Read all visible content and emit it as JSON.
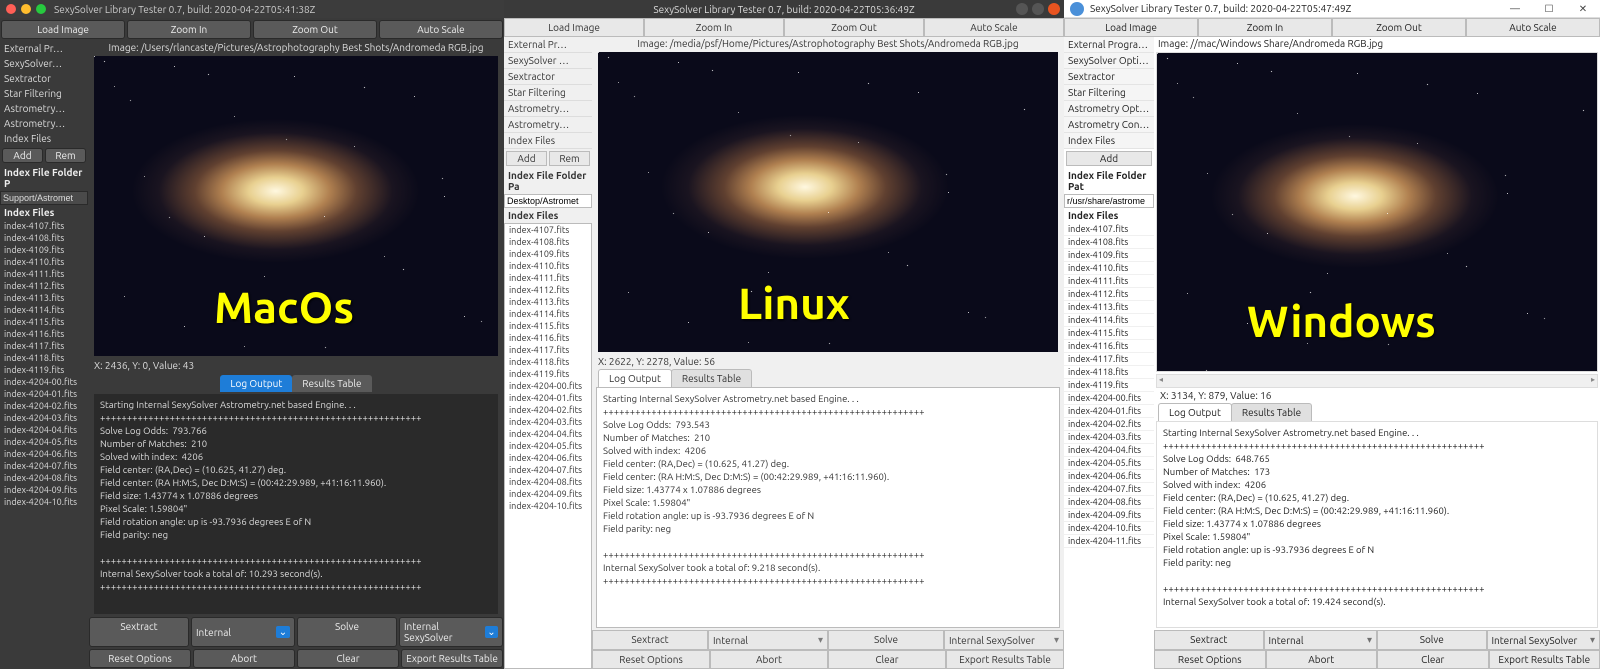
{
  "app_title_base": "SexySolver Library Tester 0.7, build:",
  "mac": {
    "title": "SexySolver Library Tester 0.7, build: 2020-04-22T05:41:38Z",
    "image_path": "Image: /Users/rlancaste/Pictures/Astrophotography Best Shots/Andromeda RGB.jpg",
    "status": "X: 2436, Y: 0, Value: 43",
    "label": "MacOs",
    "sidebar": {
      "options": [
        "External Pr…",
        "SexySolver…",
        "Sextractor",
        "Star Filtering",
        "Astrometry…",
        "Astrometry…",
        "Index Files"
      ],
      "add": "Add",
      "rem": "Rem",
      "folder_header": "Index File Folder P",
      "folder_path": "Support/Astromet",
      "files_header": "Index Files",
      "files": [
        "index-4107.fits",
        "index-4108.fits",
        "index-4109.fits",
        "index-4110.fits",
        "index-4111.fits",
        "index-4112.fits",
        "index-4113.fits",
        "index-4114.fits",
        "index-4115.fits",
        "index-4116.fits",
        "index-4117.fits",
        "index-4118.fits",
        "index-4119.fits",
        "index-4204-00.fits",
        "index-4204-01.fits",
        "index-4204-02.fits",
        "index-4204-03.fits",
        "index-4204-04.fits",
        "index-4204-05.fits",
        "index-4204-06.fits",
        "index-4204-07.fits",
        "index-4204-08.fits",
        "index-4204-09.fits",
        "index-4204-10.fits"
      ]
    },
    "tabs": {
      "log": "Log Output",
      "results": "Results Table"
    },
    "log": "Starting Internal SexySolver Astrometry.net based Engine. . .\n++++++++++++++++++++++++++++++++++++++++++++++++++++++++++++\nSolve Log Odds:  793.766\nNumber of Matches:  210\nSolved with index:  4206\nField center: (RA,Dec) = (10.625, 41.27) deg.\nField center: (RA H:M:S, Dec D:M:S) = (00:42:29.989, +41:16:11.960).\nField size: 1.43774 x 1.07886 degrees\nPixel Scale: 1.59804\"\nField rotation angle: up is -93.7936 degrees E of N\nField parity: neg\n\n++++++++++++++++++++++++++++++++++++++++++++++++++++++++++++\nInternal SexySolver took a total of: 10.293 second(s).\n++++++++++++++++++++++++++++++++++++++++++++++++++++++++++++",
    "bottom1": {
      "sextract": "Sextract",
      "sel1": "Internal",
      "solve": "Solve",
      "sel2": "Internal SexySolver"
    },
    "bottom2": {
      "reset": "Reset Options",
      "abort": "Abort",
      "clear": "Clear",
      "export": "Export Results Table"
    }
  },
  "linux": {
    "title": "SexySolver Library Tester 0.7, build: 2020-04-22T05:36:49Z",
    "image_path": "Image: /media/psf/Home/Pictures/Astrophotography Best Shots/Andromeda RGB.jpg",
    "status": "X: 2622, Y: 2278, Value: 56",
    "label": "Linux",
    "sidebar": {
      "options": [
        "External Pr…",
        "SexySolver …",
        "Sextractor",
        "Star Filtering",
        "Astrometry…",
        "Astrometry…",
        "Index Files"
      ],
      "add": "Add",
      "rem": "Rem",
      "folder_header": "Index File Folder Pa",
      "folder_path": "Desktop/Astromet",
      "files_header": "Index Files",
      "files": [
        "index-4107.fits",
        "index-4108.fits",
        "index-4109.fits",
        "index-4110.fits",
        "index-4111.fits",
        "index-4112.fits",
        "index-4113.fits",
        "index-4114.fits",
        "index-4115.fits",
        "index-4116.fits",
        "index-4117.fits",
        "index-4118.fits",
        "index-4119.fits",
        "index-4204-00.fits",
        "index-4204-01.fits",
        "index-4204-02.fits",
        "index-4204-03.fits",
        "index-4204-04.fits",
        "index-4204-05.fits",
        "index-4204-06.fits",
        "index-4204-07.fits",
        "index-4204-08.fits",
        "index-4204-09.fits",
        "index-4204-10.fits"
      ]
    },
    "tabs": {
      "log": "Log Output",
      "results": "Results Table"
    },
    "log": "Starting Internal SexySolver Astrometry.net based Engine. . .\n++++++++++++++++++++++++++++++++++++++++++++++++++++++++++++\nSolve Log Odds:  793.543\nNumber of Matches:  210\nSolved with index:  4206\nField center: (RA,Dec) = (10.625, 41.27) deg.\nField center: (RA H:M:S, Dec D:M:S) = (00:42:29.989, +41:16:11.960).\nField size: 1.43774 x 1.07886 degrees\nPixel Scale: 1.59804\"\nField rotation angle: up is -93.7936 degrees E of N\nField parity: neg\n\n++++++++++++++++++++++++++++++++++++++++++++++++++++++++++++\nInternal SexySolver took a total of: 9.218 second(s).\n++++++++++++++++++++++++++++++++++++++++++++++++++++++++++++",
    "bottom1": {
      "sextract": "Sextract",
      "sel1": "Internal",
      "solve": "Solve",
      "sel2": "Internal SexySolver"
    },
    "bottom2": {
      "reset": "Reset Options",
      "abort": "Abort",
      "clear": "Clear",
      "export": "Export Results Table"
    }
  },
  "win": {
    "title": "SexySolver Library Tester 0.7, build: 2020-04-22T05:47:49Z",
    "image_path": "Image: //mac/Windows Share/Andromeda RGB.jpg",
    "status": "X: 3134, Y: 879, Value: 16",
    "label": "Windows",
    "sidebar": {
      "options": [
        "External Program …",
        "SexySolver Options",
        "Sextractor",
        "Star Filtering",
        "Astrometry Options",
        "Astrometry Config",
        "Index Files"
      ],
      "add": "Add",
      "folder_header": "Index File Folder Pat",
      "folder_path": "r/usr/share/astrome",
      "files_header": "Index Files",
      "files": [
        "index-4107.fits",
        "index-4108.fits",
        "index-4109.fits",
        "index-4110.fits",
        "index-4111.fits",
        "index-4112.fits",
        "index-4113.fits",
        "index-4114.fits",
        "index-4115.fits",
        "index-4116.fits",
        "index-4117.fits",
        "index-4118.fits",
        "index-4119.fits",
        "index-4204-00.fits",
        "index-4204-01.fits",
        "index-4204-02.fits",
        "index-4204-03.fits",
        "index-4204-04.fits",
        "index-4204-05.fits",
        "index-4204-06.fits",
        "index-4204-07.fits",
        "index-4204-08.fits",
        "index-4204-09.fits",
        "index-4204-10.fits",
        "index-4204-11.fits"
      ]
    },
    "tabs": {
      "log": "Log Output",
      "results": "Results Table"
    },
    "log": "Starting Internal SexySolver Astrometry.net based Engine. . .\n++++++++++++++++++++++++++++++++++++++++++++++++++++++++++++\nSolve Log Odds:  648.765\nNumber of Matches:  173\nSolved with index:  4206\nField center: (RA,Dec) = (10.625, 41.27) deg.\nField center: (RA H:M:S, Dec D:M:S) = (00:42:29.989, +41:16:11.960).\nField size: 1.43774 x 1.07886 degrees\nPixel Scale: 1.59804\"\nField rotation angle: up is -93.7936 degrees E of N\nField parity: neg\n\n++++++++++++++++++++++++++++++++++++++++++++++++++++++++++++\nInternal SexySolver took a total of: 19.424 second(s).",
    "bottom1": {
      "sextract": "Sextract",
      "sel1": "Internal",
      "solve": "Solve",
      "sel2": "Internal SexySolver"
    },
    "bottom2": {
      "reset": "Reset Options",
      "abort": "Abort",
      "clear": "Clear",
      "export": "Export Results Table"
    }
  },
  "toolbar": {
    "load": "Load Image",
    "zoomin": "Zoom In",
    "zoomout": "Zoom Out",
    "autoscale": "Auto Scale"
  }
}
